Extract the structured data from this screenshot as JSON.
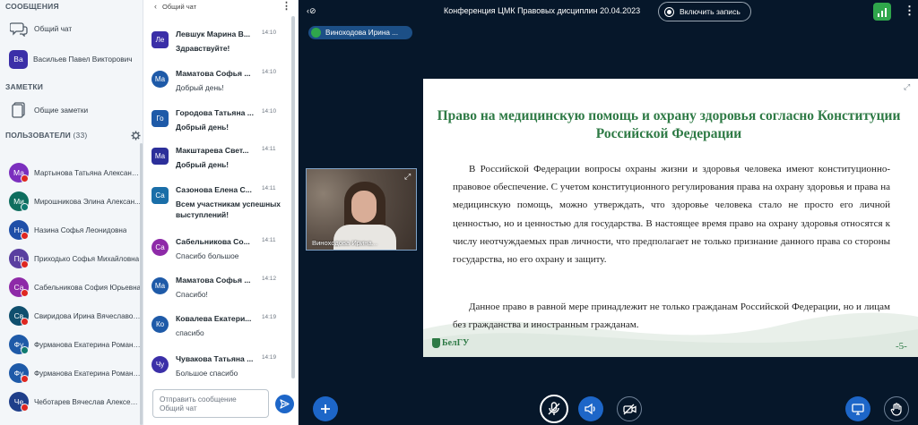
{
  "sidebar": {
    "messages_title": "СООБЩЕНИЯ",
    "public_chat": "Общий чат",
    "private_chat_user": "Васильев Павел Викторович",
    "private_chat_initials": "Ва",
    "notes_title": "ЗАМЕТКИ",
    "shared_notes": "Общие заметки",
    "users_title": "ПОЛЬЗОВАТЕЛИ",
    "users_count": "(33)",
    "users": [
      {
        "initials": "Ма",
        "name": "Мартынова Татьяна Александ...",
        "color": "#7b2fbe",
        "status": "red"
      },
      {
        "initials": "Ми",
        "name": "Мирошникова Элина Алексан...",
        "color": "#0f6e5f",
        "status": "teal"
      },
      {
        "initials": "На",
        "name": "Назина Софья Леонидовна",
        "color": "#1f4fa8",
        "status": "red"
      },
      {
        "initials": "Пр",
        "name": "Приходько Софья Михайловна",
        "color": "#5a3fa0",
        "status": "red"
      },
      {
        "initials": "Са",
        "name": "Сабельникова София Юрьевна",
        "color": "#8e2aa8",
        "status": "red"
      },
      {
        "initials": "Св",
        "name": "Свиридова Ирина Вячеславовна",
        "color": "#0f4f6e",
        "status": "red"
      },
      {
        "initials": "Фу",
        "name": "Фурманова Екатерина Романо...",
        "color": "#1e5aa8",
        "status": "teal"
      },
      {
        "initials": "Фу",
        "name": "Фурманова Екатерина Романо...",
        "color": "#1e5aa8",
        "status": "red"
      },
      {
        "initials": "Че",
        "name": "Чеботарев Вячеслав Алексеев...",
        "color": "#1f3f8a",
        "status": "red"
      }
    ]
  },
  "chat": {
    "title": "Общий чат",
    "input_placeholder": "Отправить сообщение Общий чат",
    "messages": [
      {
        "initials": "Ле",
        "name": "Левшук Марина В...",
        "time": "14:10",
        "text": "Здравствуйте!",
        "color": "#3b2fa8",
        "shape": "square",
        "bold": true
      },
      {
        "initials": "Ма",
        "name": "Маматова Софья ...",
        "time": "14:10",
        "text": "Добрый день!",
        "color": "#1e5aa8",
        "shape": "round",
        "bold": false
      },
      {
        "initials": "Го",
        "name": "Городова Татьяна ...",
        "time": "14:10",
        "text": "Добрый день!",
        "color": "#1e5aa8",
        "shape": "square",
        "bold": true
      },
      {
        "initials": "Ма",
        "name": "Макштарева Свет...",
        "time": "14:11",
        "text": "Добрый день!",
        "color": "#2c2f9a",
        "shape": "square",
        "bold": true
      },
      {
        "initials": "Са",
        "name": "Сазонова Елена С...",
        "time": "14:11",
        "text": "Всем участникам успешных выступлений!",
        "color": "#1a6ea8",
        "shape": "square",
        "bold": true
      },
      {
        "initials": "Са",
        "name": "Сабельникова Со...",
        "time": "14:11",
        "text": "Спасибо большое",
        "color": "#8e2aa8",
        "shape": "round",
        "bold": false
      },
      {
        "initials": "Ма",
        "name": "Маматова Софья ...",
        "time": "14:12",
        "text": "Спасибо!",
        "color": "#1e5aa8",
        "shape": "round",
        "bold": false
      },
      {
        "initials": "Ко",
        "name": "Ковалева Екатери...",
        "time": "14:19",
        "text": "спасибо",
        "color": "#1e5aa8",
        "shape": "round",
        "bold": false
      },
      {
        "initials": "Чу",
        "name": "Чувакова Татьяна ...",
        "time": "14:19",
        "text": "Большое спасибо",
        "color": "#3b2fa8",
        "shape": "round",
        "bold": false
      }
    ]
  },
  "main": {
    "conference_title": "Конференция ЦМК Правовых дисциплин 20.04.2023",
    "record_label": "Включить запись",
    "presenter_name": "Виноходова Ирина ...",
    "webcam_label": "Виноходова Ирина...",
    "slide": {
      "title": "Право на медицинскую помощь и охрану здоровья согласно Конституции Российской Федерации",
      "paragraph1": "В Российской Федерации вопросы охраны жизни и здоровья человека имеют конституционно-правовое обеспечение. С учетом конституционного регулирования права на охрану здоровья и права на медицинскую помощь, можно утверждать, что здоровье человека стало не просто его личной ценностью, но и ценностью для государства. В настоящее время право на охрану здоровья относятся к числу неотчуждаемых прав личности, что предполагает не только признание данного права со стороны государства, но его охрану и защиту.",
      "paragraph2": "Данное право в равной мере принадлежит не только гражданам Российской Федерации, но и лицам без гражданства и иностранным гражданам.",
      "logo_text": "БелГУ",
      "page_number": "-5-"
    }
  },
  "colors": {
    "background": "#06172a",
    "accent_blue": "#1d66c8",
    "slide_green": "#2e7a45",
    "signal_green": "#2fa64b",
    "mute_red": "#df2721"
  }
}
